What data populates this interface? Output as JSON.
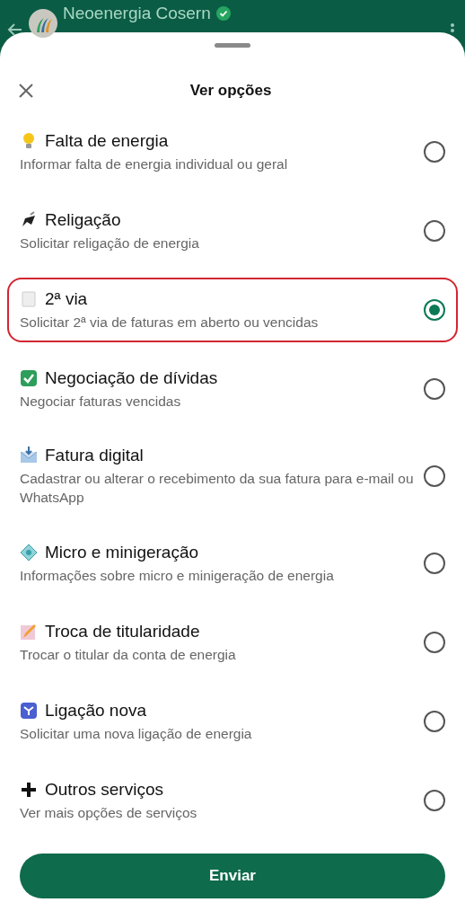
{
  "chat_header": {
    "title": "Neoenergia Cosern",
    "verified": true
  },
  "sheet": {
    "title": "Ver opções"
  },
  "options": [
    {
      "title": "Falta de energia",
      "subtitle": "Informar falta de energia individual ou geral",
      "selected": false
    },
    {
      "title": "Religação",
      "subtitle": "Solicitar religação de energia",
      "selected": false
    },
    {
      "title": "2ª via",
      "subtitle": "Solicitar 2ª via de faturas em aberto ou vencidas",
      "selected": true
    },
    {
      "title": "Negociação de dívidas",
      "subtitle": "Negociar faturas vencidas",
      "selected": false
    },
    {
      "title": "Fatura digital",
      "subtitle": "Cadastrar ou alterar o recebimento da sua fatura para e-mail ou WhatsApp",
      "selected": false
    },
    {
      "title": "Micro e minigeração",
      "subtitle": "Informações sobre micro e minigeração de energia",
      "selected": false
    },
    {
      "title": "Troca de titularidade",
      "subtitle": "Trocar o titular da conta de energia",
      "selected": false
    },
    {
      "title": "Ligação nova",
      "subtitle": "Solicitar uma nova ligação de energia",
      "selected": false
    },
    {
      "title": "Outros serviços",
      "subtitle": "Ver mais opções de serviços",
      "selected": false
    }
  ],
  "submit_button": "Enviar"
}
